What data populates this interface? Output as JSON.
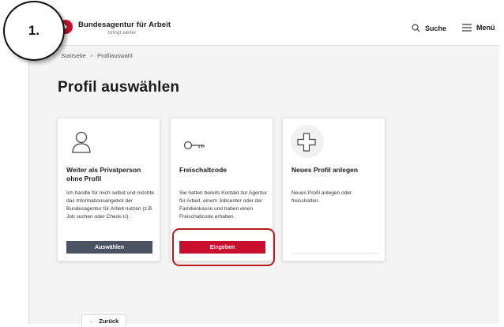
{
  "header": {
    "brand_name": "Bundesagentur für Arbeit",
    "brand_tagline": "bringt weiter",
    "search_label": "Suche",
    "menu_label": "Menü",
    "accent_color": "#c8102e"
  },
  "breadcrumb": {
    "home": "Startseite",
    "separator": ">",
    "current": "Profilauswahl"
  },
  "page_title": "Profil auswählen",
  "cards": [
    {
      "icon": "person-icon",
      "title": "Weiter als Privatperson ohne Profil",
      "text": "Ich handle für mich selbst und möchte das Informationsangebot der Bundesagentur für Arbeit nutzen (z.B. Job suchen oder Check-U).",
      "button_label": "Auswählen"
    },
    {
      "icon": "key-icon",
      "title": "Freischaltcode",
      "text": "Sie hatten bereits Kontakt zur Agentur für Arbeit, einem Jobcenter oder der Familienkasse und haben einen Freischaltcode erhalten.",
      "button_label": "Eingeben"
    },
    {
      "icon": "plus-icon",
      "title": "Neues Profil anlegen",
      "text": "Neues Profil anlegen oder freischalten."
    }
  ],
  "back_label": "Zurück",
  "annotation": {
    "step_label": "1.",
    "highlight_color": "#b71c1c"
  }
}
